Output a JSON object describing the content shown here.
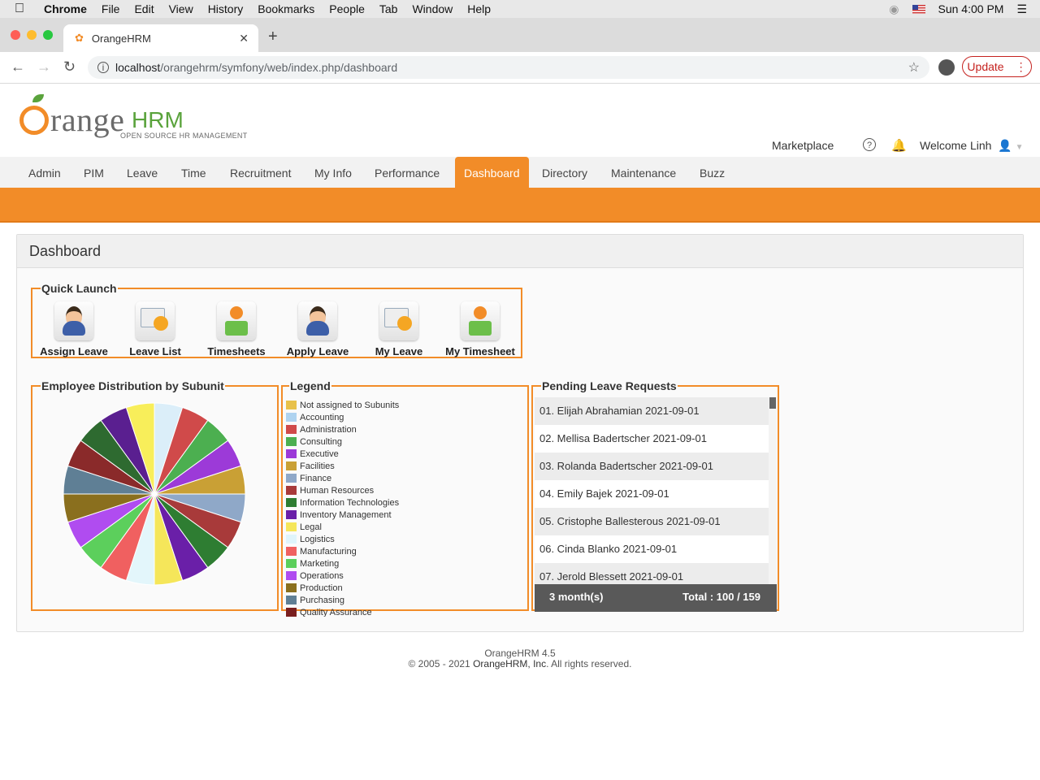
{
  "menubar": {
    "app": "Chrome",
    "items": [
      "File",
      "Edit",
      "View",
      "History",
      "Bookmarks",
      "People",
      "Tab",
      "Window",
      "Help"
    ],
    "clock": "Sun 4:00 PM"
  },
  "browser": {
    "tab_title": "OrangeHRM",
    "url_host": "localhost",
    "url_path": "/orangehrm/symfony/web/index.php/dashboard",
    "update_label": "Update"
  },
  "header": {
    "logo_text": "range",
    "logo_hrm": "HRM",
    "logo_tagline": "OPEN SOURCE HR MANAGEMENT",
    "marketplace": "Marketplace",
    "welcome": "Welcome Linh"
  },
  "mainmenu": {
    "items": [
      "Admin",
      "PIM",
      "Leave",
      "Time",
      "Recruitment",
      "My Info",
      "Performance",
      "Dashboard",
      "Directory",
      "Maintenance",
      "Buzz"
    ],
    "active": "Dashboard"
  },
  "dashboard": {
    "title": "Dashboard",
    "quick_launch": {
      "title": "Quick Launch",
      "items": [
        "Assign Leave",
        "Leave List",
        "Timesheets",
        "Apply Leave",
        "My Leave",
        "My Timesheet"
      ]
    },
    "distribution": {
      "title": "Employee Distribution by Subunit"
    },
    "legend": {
      "title": "Legend",
      "items": [
        {
          "label": "Not assigned to Subunits",
          "color": "#e8c14a"
        },
        {
          "label": "Accounting",
          "color": "#aed3f0"
        },
        {
          "label": "Administration",
          "color": "#d04a4a"
        },
        {
          "label": "Consulting",
          "color": "#4caf50"
        },
        {
          "label": "Executive",
          "color": "#9c3ad8"
        },
        {
          "label": "Facilities",
          "color": "#c9a035"
        },
        {
          "label": "Finance",
          "color": "#8fa8c8"
        },
        {
          "label": "Human Resources",
          "color": "#a83a3a"
        },
        {
          "label": "Information Technologies",
          "color": "#2e7d32"
        },
        {
          "label": "Inventory Management",
          "color": "#6a1fa8"
        },
        {
          "label": "Legal",
          "color": "#f5e65a"
        },
        {
          "label": "Logistics",
          "color": "#dff4fb"
        },
        {
          "label": "Manufacturing",
          "color": "#f06060"
        },
        {
          "label": "Marketing",
          "color": "#5ccf5c"
        },
        {
          "label": "Operations",
          "color": "#b04cf0"
        },
        {
          "label": "Production",
          "color": "#8a6f1e"
        },
        {
          "label": "Purchasing",
          "color": "#5f7f95"
        },
        {
          "label": "Quality Assurance",
          "color": "#7a1f1f"
        }
      ]
    },
    "pending": {
      "title": "Pending Leave Requests",
      "rows": [
        "01. Elijah Abrahamian 2021-09-01",
        "02. Mellisa Badertscher 2021-09-01",
        "03. Rolanda Badertscher 2021-09-01",
        "04. Emily Bajek 2021-09-01",
        "05. Cristophe Ballesterous 2021-09-01",
        "06. Cinda Blanko 2021-09-01",
        "07. Jerold Blessett 2021-09-01"
      ],
      "period": "3 month(s)",
      "total": "Total : 100 / 159"
    }
  },
  "chart_data": {
    "type": "pie",
    "title": "",
    "categories": [
      "Accounting",
      "Administration",
      "Consulting",
      "Executive",
      "Facilities",
      "Finance",
      "Human Resources",
      "Information Technologies",
      "Inventory Management",
      "Legal",
      "Logistics",
      "Manufacturing",
      "Marketing",
      "Operations",
      "Production",
      "Purchasing",
      "Human Resources",
      "Information Technologies",
      "Inventory Management",
      "Legal"
    ],
    "values": [
      1,
      1,
      1,
      1,
      1,
      1,
      1,
      1,
      1,
      1,
      1,
      1,
      1,
      1,
      1,
      1,
      1,
      1,
      1,
      1
    ],
    "colors": [
      "#dbeef9",
      "#d04a4a",
      "#4caf50",
      "#9c3ad8",
      "#c9a035",
      "#8fa8c8",
      "#a83a3a",
      "#2e7d32",
      "#6a1fa8",
      "#f5e65a",
      "#e3f6fb",
      "#f06060",
      "#5ccf5c",
      "#b04cf0",
      "#8a6f1e",
      "#5f7f95",
      "#8a2a2a",
      "#2e6a30",
      "#5a1f90",
      "#f8ee5a"
    ]
  },
  "footer": {
    "version": "OrangeHRM 4.5",
    "copyright_prefix": "© 2005 - 2021 ",
    "company": "OrangeHRM, Inc",
    "copyright_suffix": ". All rights reserved."
  }
}
